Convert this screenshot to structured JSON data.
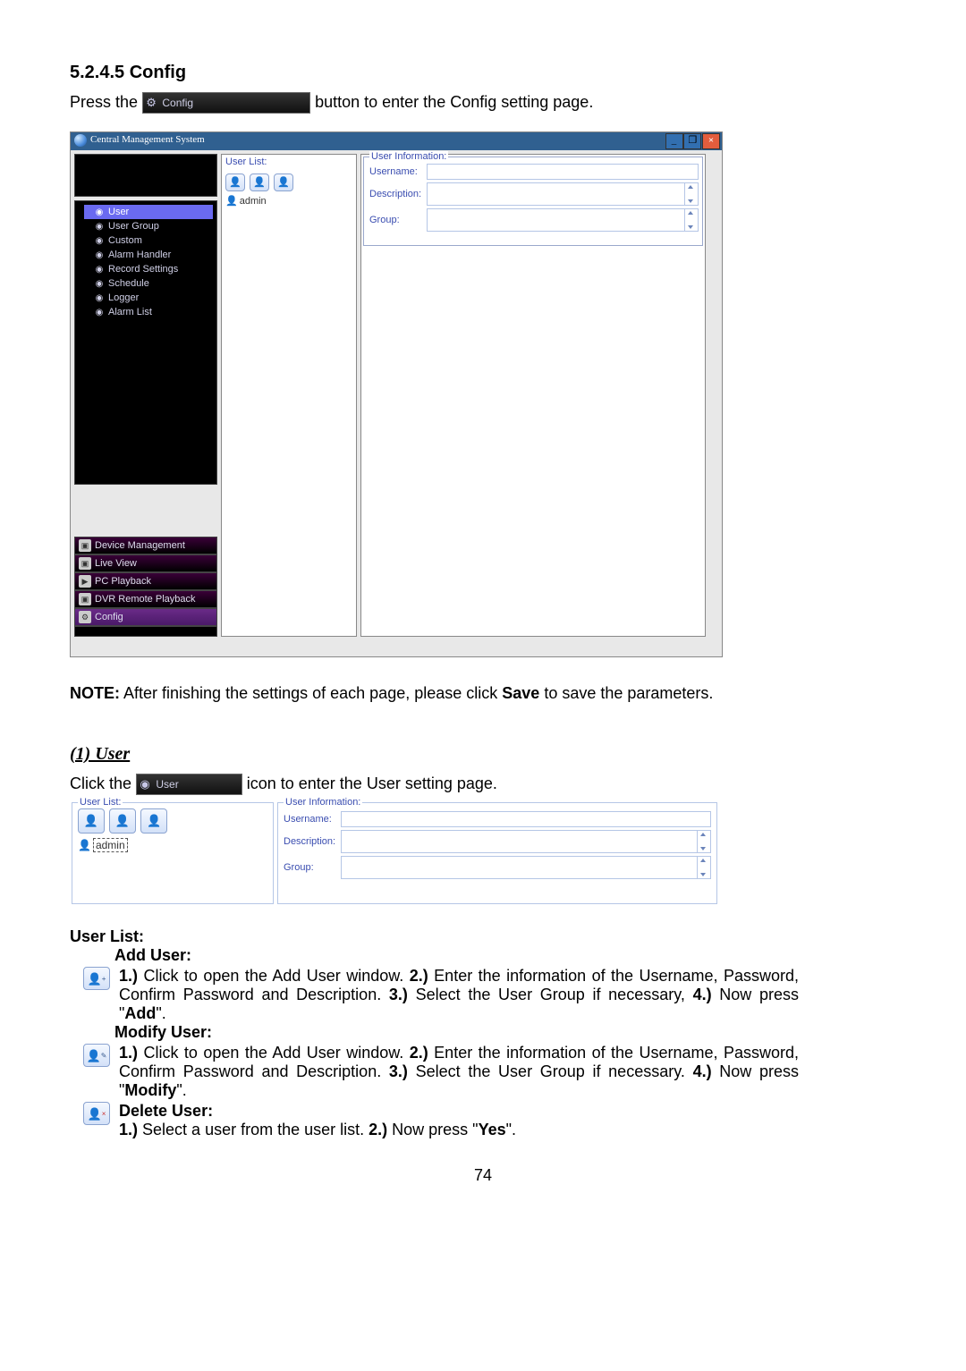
{
  "section_heading": "5.2.4.5 Config",
  "press_prefix": "Press the ",
  "config_button_label": "Config",
  "press_suffix": " button to enter the Config setting page.",
  "cms_title": "Central Management System",
  "winbtns": {
    "min": "_",
    "max": "❐",
    "close": "×"
  },
  "left_panel": {
    "user_list_label": "User List:",
    "admin_user": "admin",
    "tree": [
      {
        "icon": "◆",
        "label": "User"
      },
      {
        "icon": "◆",
        "label": "User Group"
      },
      {
        "icon": "◆",
        "label": "Custom"
      },
      {
        "icon": "◆",
        "label": "Alarm Handler"
      },
      {
        "icon": "◆",
        "label": "Record Settings"
      },
      {
        "icon": "◆",
        "label": "Schedule"
      },
      {
        "icon": "◆",
        "label": "Logger"
      },
      {
        "icon": "◆",
        "label": "Alarm List"
      }
    ],
    "bottom_nav": [
      "Device Management",
      "Live View",
      "PC Playback",
      "DVR Remote Playback",
      "Config"
    ]
  },
  "user_info": {
    "legend": "User Information:",
    "username_label": "Username:",
    "description_label": "Description:",
    "group_label": "Group:"
  },
  "note_line_parts": [
    "NOTE:",
    " After finishing the settings of each page, please click ",
    "Save",
    " to save the parameters."
  ],
  "subsection": "(1) User",
  "user_click": {
    "prefix": "Click the ",
    "chip": "User",
    "suffix": " icon to enter the User setting page."
  },
  "user_list_heading": "User List:",
  "add_user_heading": "Add User:",
  "add_user_steps": [
    "1.)",
    " Click to open the Add User window. ",
    "2.)",
    " Enter the information of the Username, Password, Confirm Password and Description. ",
    "3.)",
    " Select the User Group if necessary, ",
    "4.)",
    " Now press \"",
    "Add",
    "\"."
  ],
  "modify_user_heading": "Modify User:",
  "modify_user_steps": [
    "1.)",
    " Click to open the Add User window. ",
    "2.)",
    " Enter the information of the Username, Password, Confirm Password and Description. ",
    "3.)",
    " Select the User Group if necessary. ",
    "4.)",
    " Now press \"",
    "Modify",
    "\"."
  ],
  "delete_user_heading": "Delete User:",
  "delete_user_steps": [
    "1.)",
    " Select a user from the user list. ",
    "2.)",
    " Now press \"",
    "Yes",
    "\"."
  ],
  "page_number": "74"
}
